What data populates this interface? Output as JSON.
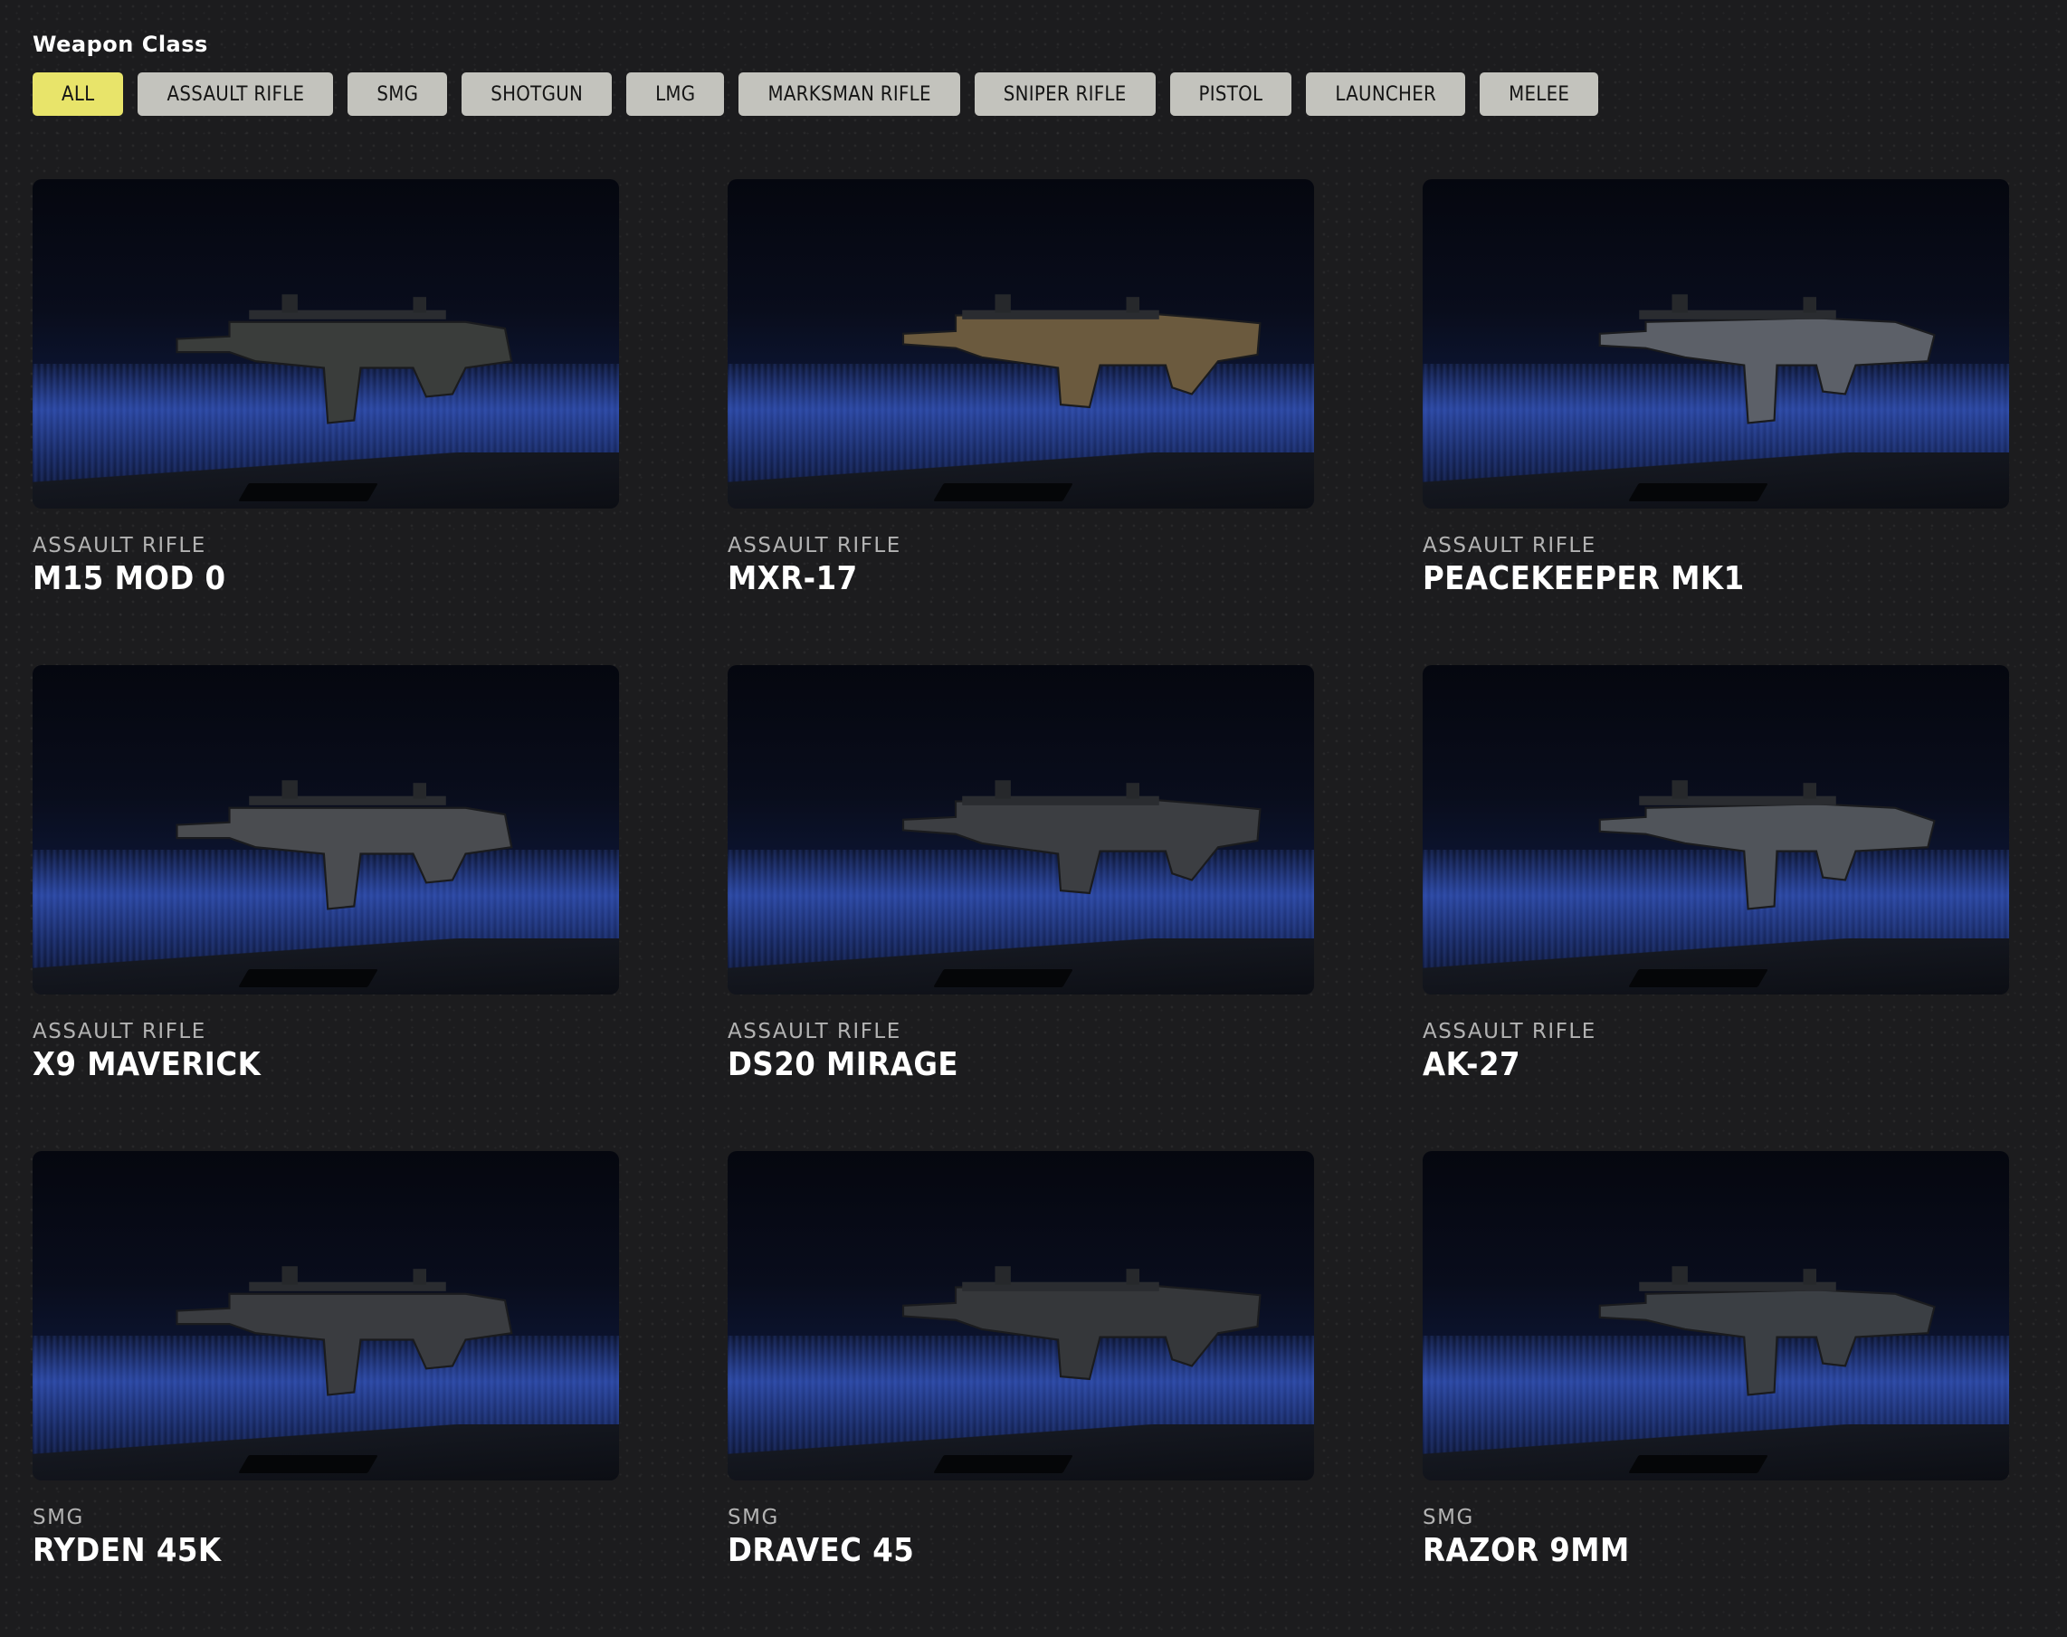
{
  "filter": {
    "title": "Weapon Class",
    "buttons": [
      {
        "label": "ALL",
        "active": true
      },
      {
        "label": "ASSAULT RIFLE"
      },
      {
        "label": "SMG"
      },
      {
        "label": "SHOTGUN"
      },
      {
        "label": "LMG"
      },
      {
        "label": "MARKSMAN RIFLE"
      },
      {
        "label": "SNIPER RIFLE"
      },
      {
        "label": "PISTOL"
      },
      {
        "label": "LAUNCHER"
      },
      {
        "label": "MELEE"
      }
    ]
  },
  "weapons": [
    {
      "class": "ASSAULT RIFLE",
      "name": "M15 MOD 0",
      "tint": "#3a3d3b"
    },
    {
      "class": "ASSAULT RIFLE",
      "name": "MXR-17",
      "tint": "#6b5a3e"
    },
    {
      "class": "ASSAULT RIFLE",
      "name": "PEACEKEEPER MK1",
      "tint": "#5c6068"
    },
    {
      "class": "ASSAULT RIFLE",
      "name": "X9 MAVERICK",
      "tint": "#4a4c50"
    },
    {
      "class": "ASSAULT RIFLE",
      "name": "DS20 MIRAGE",
      "tint": "#3c3e42"
    },
    {
      "class": "ASSAULT RIFLE",
      "name": "AK-27",
      "tint": "#50545a"
    },
    {
      "class": "SMG",
      "name": "RYDEN 45K",
      "tint": "#3a3c40"
    },
    {
      "class": "SMG",
      "name": "DRAVEC 45",
      "tint": "#35373a"
    },
    {
      "class": "SMG",
      "name": "RAZOR 9MM",
      "tint": "#3b3f44"
    }
  ],
  "colors": {
    "active_filter": "#e8e46a",
    "inactive_filter": "#c3c3bd",
    "background": "#1c1c1e"
  }
}
